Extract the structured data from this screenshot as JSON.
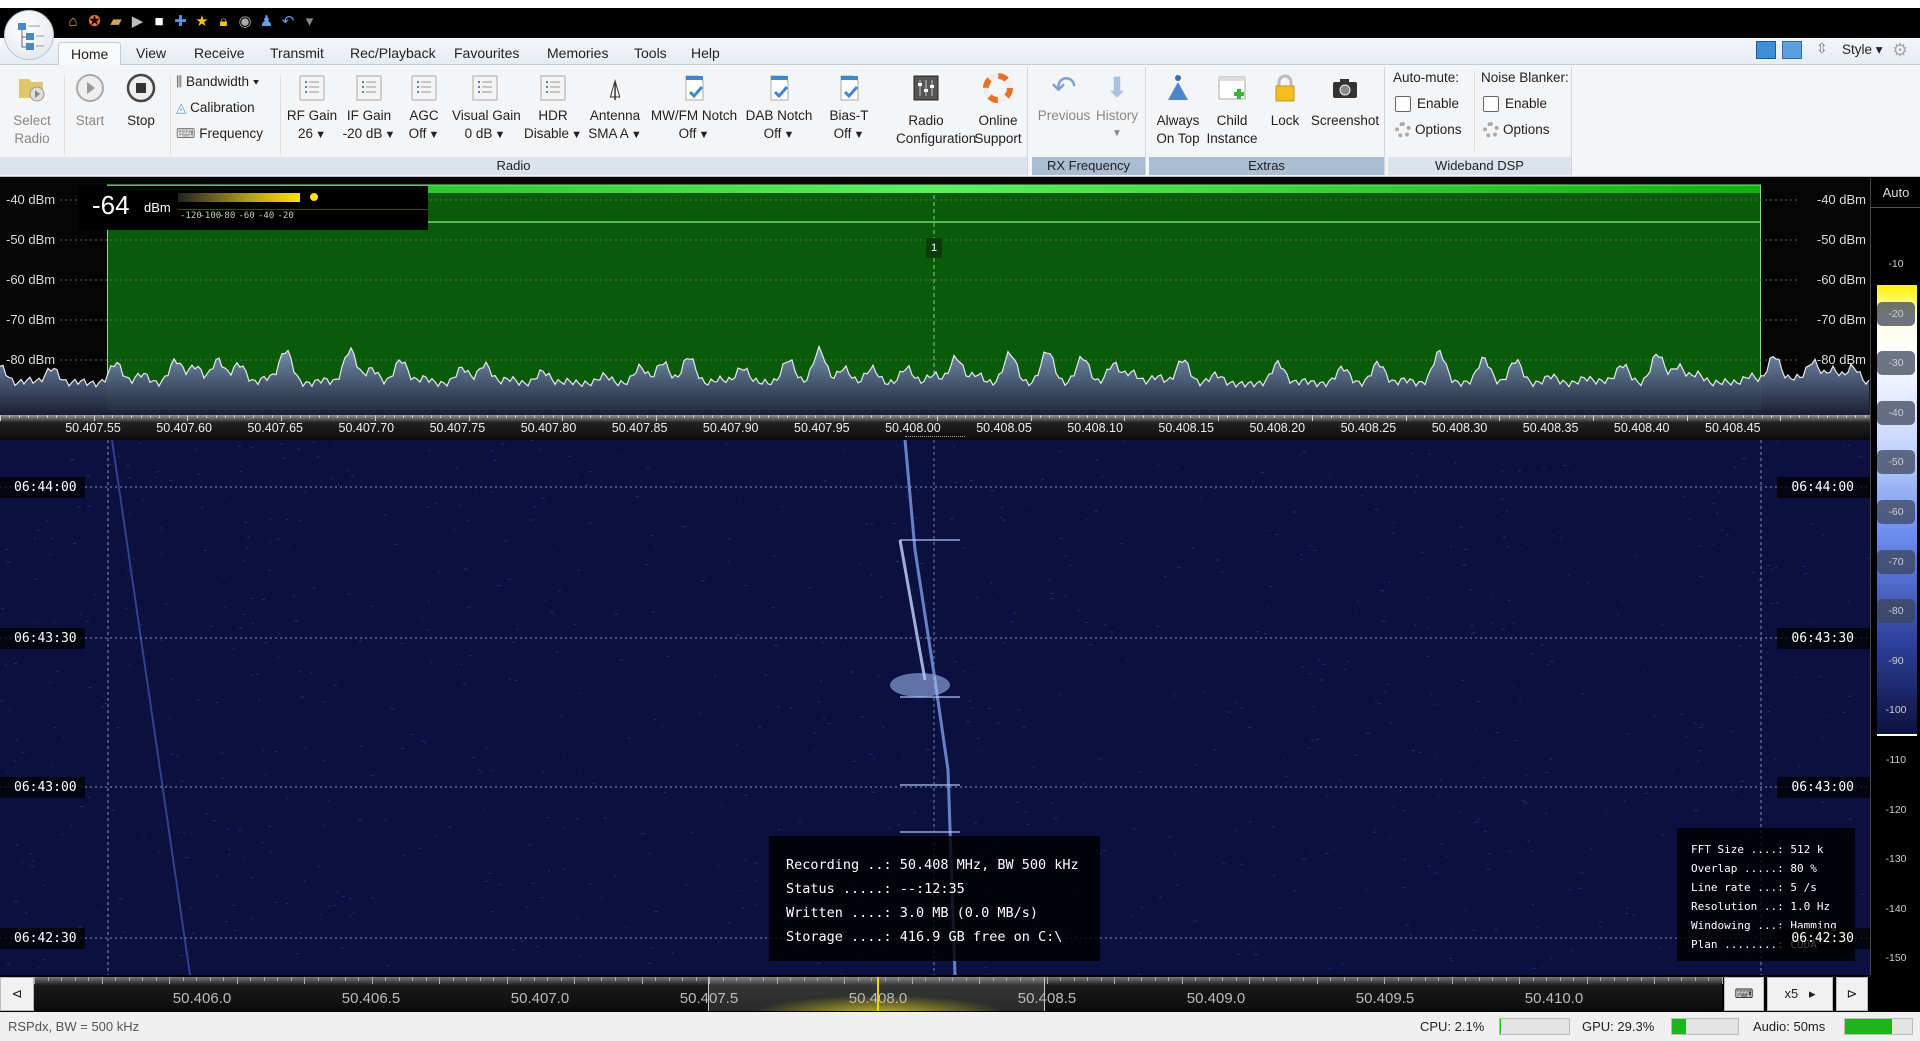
{
  "quick_access": {
    "icons": [
      "home-icon",
      "lifebuoy-icon",
      "folder-icon",
      "play-icon",
      "stop-icon",
      "plus-icon",
      "star-icon",
      "lock-icon",
      "camera-icon",
      "person-icon",
      "undo-icon",
      "customize-dropdown-icon"
    ]
  },
  "menu_tabs": [
    "Home",
    "View",
    "Receive",
    "Transmit",
    "Rec/Playback",
    "Favourites",
    "Memories",
    "Tools",
    "Help"
  ],
  "active_tab": "Home",
  "top_right": {
    "style_label": "Style"
  },
  "ribbon": {
    "radio": {
      "label": "Radio",
      "select_radio": "Select\nRadio",
      "start": "Start",
      "stop": "Stop",
      "bandwidth": "Bandwidth",
      "calibration": "Calibration",
      "frequency": "Frequency",
      "rf_gain": {
        "label": "RF Gain",
        "value": "26"
      },
      "if_gain": {
        "label": "IF Gain",
        "value": "-20 dB"
      },
      "agc": {
        "label": "AGC",
        "value": "Off"
      },
      "visual_gain": {
        "label": "Visual Gain",
        "value": "0 dB"
      },
      "hdr": {
        "label": "HDR",
        "value": "Disable"
      },
      "antenna": {
        "label": "Antenna",
        "value": "SMA A"
      },
      "mwfm_notch": {
        "label": "MW/FM Notch",
        "value": "Off"
      },
      "dab_notch": {
        "label": "DAB Notch",
        "value": "Off"
      },
      "bias_t": {
        "label": "Bias-T",
        "value": "Off"
      },
      "radio_config": {
        "l1": "Radio",
        "l2": "Configuration"
      },
      "online_support": {
        "l1": "Online",
        "l2": "Support"
      }
    },
    "rx_frequency": {
      "label": "RX Frequency",
      "previous": "Previous",
      "history": "History"
    },
    "extras": {
      "label": "Extras",
      "always_on_top": {
        "l1": "Always",
        "l2": "On Top"
      },
      "child_instance": {
        "l1": "Child",
        "l2": "Instance"
      },
      "lock": "Lock",
      "screenshot": "Screenshot"
    },
    "wideband_dsp": {
      "label": "Wideband DSP",
      "auto_mute": "Auto-mute:",
      "noise_blanker": "Noise Blanker:",
      "enable": "Enable",
      "options": "Options",
      "auto_mute_enabled": false,
      "noise_blanker_enabled": false
    }
  },
  "spectrum": {
    "signal_level": "-64",
    "signal_unit": "dBm",
    "meter_scale": [
      "-120",
      "-100",
      "-80",
      "-60",
      "-40",
      "-20"
    ],
    "db_labels": [
      "-40 dBm",
      "-50 dBm",
      "-60 dBm",
      "-70 dBm",
      "-80 dBm"
    ],
    "vfo_marker": "1",
    "freq_labels": [
      "50.407.55",
      "50.407.60",
      "50.407.65",
      "50.407.70",
      "50.407.75",
      "50.407.80",
      "50.407.85",
      "50.407.90",
      "50.407.95",
      "50.408.00",
      "50.408.05",
      "50.408.10",
      "50.408.15",
      "50.408.20",
      "50.408.25",
      "50.408.30",
      "50.408.35",
      "50.408.40",
      "50.408.45"
    ],
    "colors": {
      "passband": "#0b6a0b",
      "trace": "#e8e8e8"
    }
  },
  "colorbar": {
    "auto_label": "Auto",
    "labels": [
      "-10",
      "-20",
      "-30",
      "-40",
      "-50",
      "-60",
      "-70",
      "-80",
      "-90",
      "-100",
      "-110",
      "-120",
      "-130",
      "-140",
      "-150"
    ]
  },
  "waterfall": {
    "time_labels": [
      "06:44:00",
      "06:43:30",
      "06:43:00",
      "06:42:30"
    ],
    "recording_info": [
      "Recording ..: 50.408 MHz, BW 500 kHz",
      "Status .....: --:12:35",
      "Written ....: 3.0 MB (0.0 MB/s)",
      "Storage ....: 416.9 GB free on C:\\"
    ],
    "fft_info": [
      "FFT Size ....: 512 k",
      "Overlap .....: 80 %",
      "Line rate ...: 5 /s",
      "Resolution ..: 1.0 Hz",
      "Windowing ...: Hamming",
      "Plan ........: CUDA"
    ]
  },
  "overview": {
    "freq_labels": [
      "50.406.0",
      "50.406.5",
      "50.407.0",
      "50.407.5",
      "50.408.0",
      "50.408.5",
      "50.409.0",
      "50.409.5",
      "50.410.0"
    ],
    "zoom": "x5"
  },
  "status": {
    "device": "RSPdx, BW = 500 kHz",
    "cpu": "CPU: 2.1%",
    "cpu_pct": 2.1,
    "gpu": "GPU: 29.3%",
    "gpu_pct": 29.3,
    "audio": "Audio: 50ms",
    "audio_level_pct": 70
  }
}
